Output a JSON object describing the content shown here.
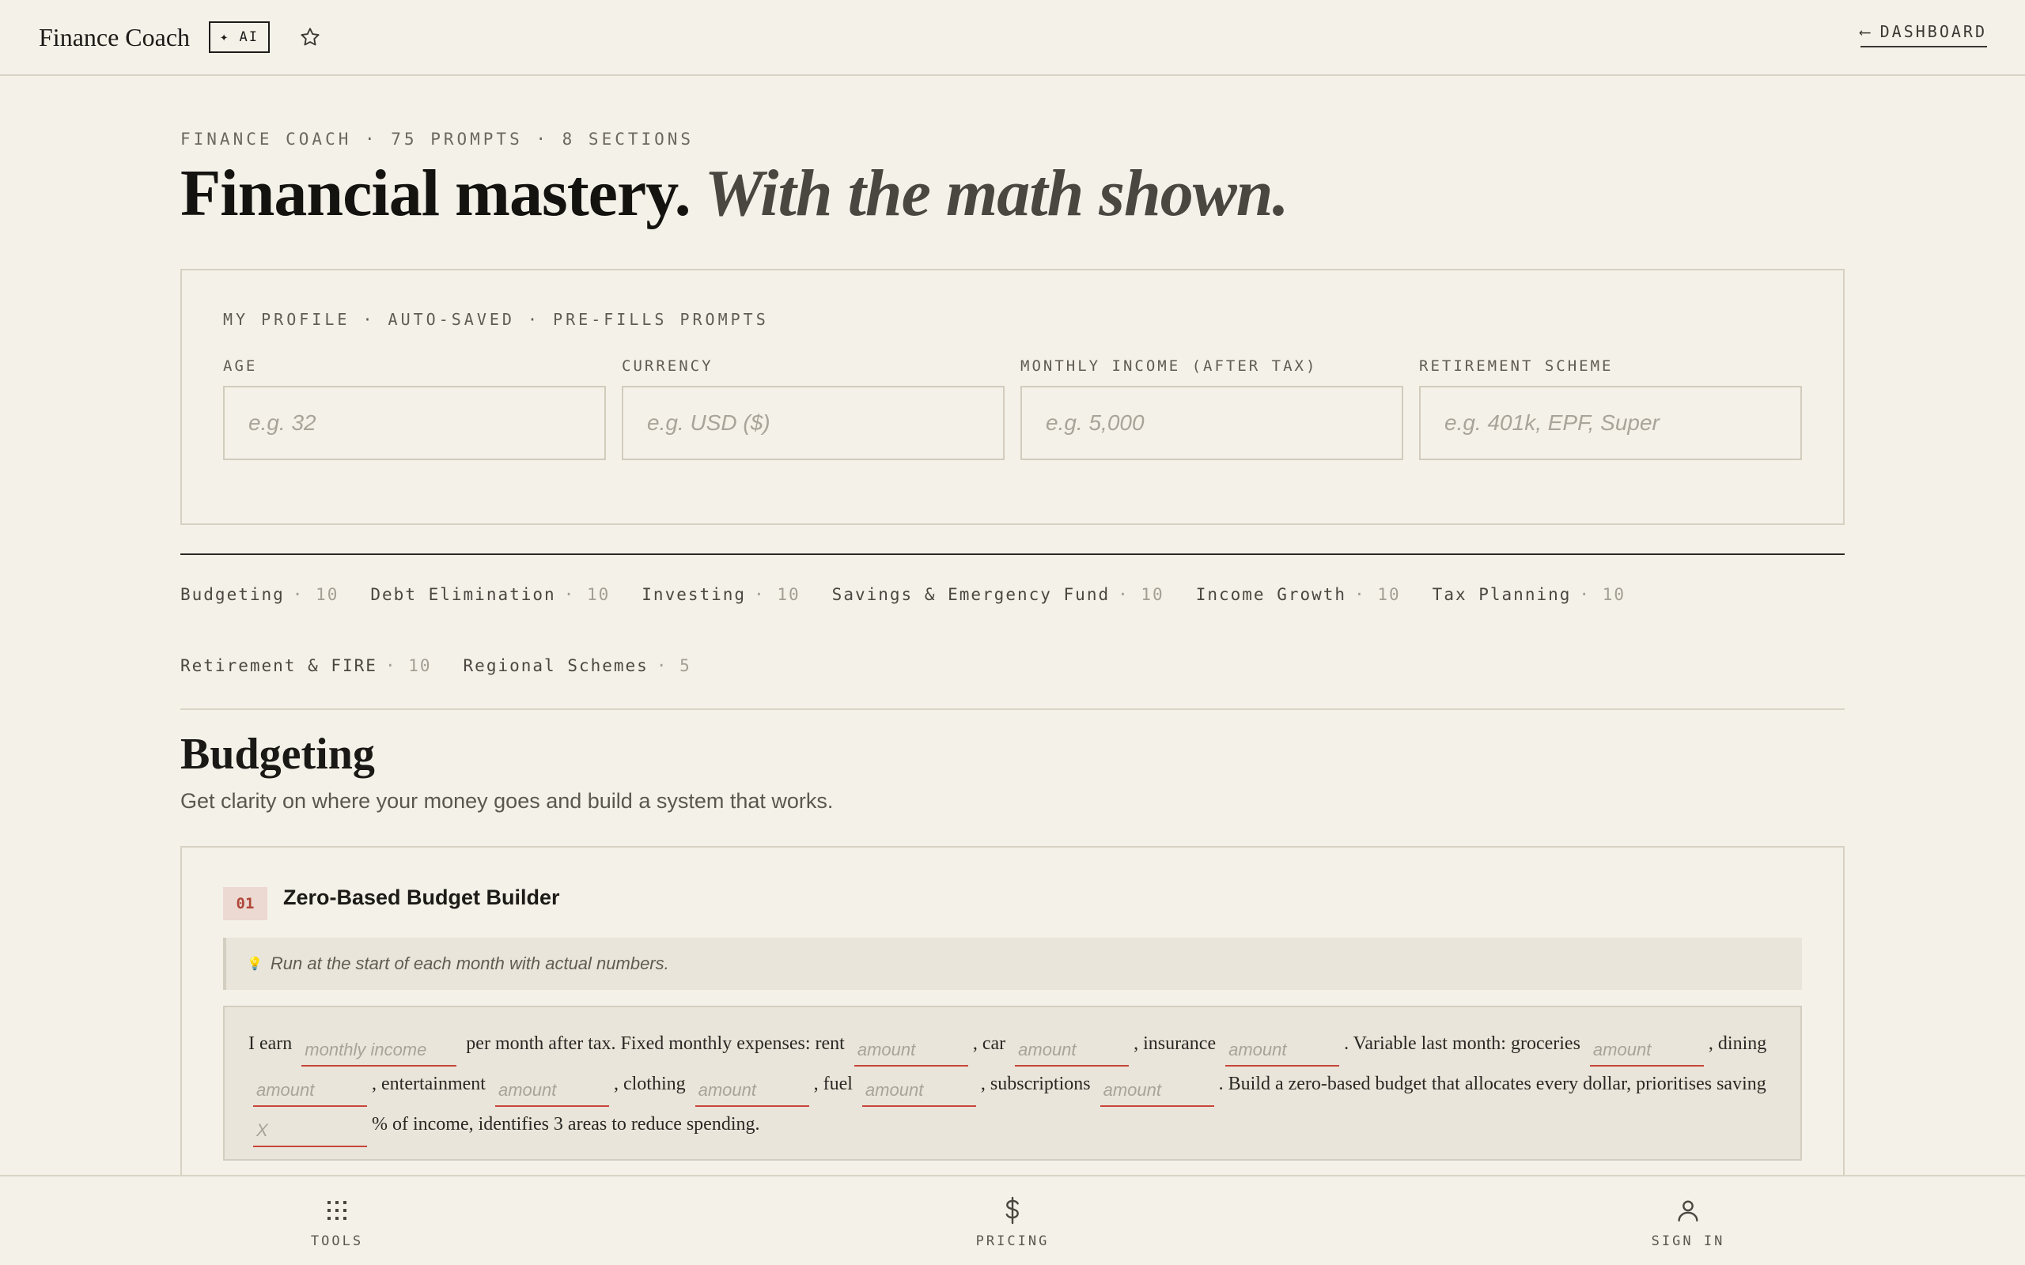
{
  "header": {
    "app_title": "Finance Coach",
    "ai_badge": "✦ AI",
    "favorite_icon": "star-icon",
    "back_arrow": "⟵",
    "dashboard_link": "DASHBOARD"
  },
  "hero": {
    "eyebrow": "FINANCE COACH · 75 PROMPTS · 8 SECTIONS",
    "headline": "Financial mastery.",
    "headline_italic": "With the math shown."
  },
  "profile": {
    "eyebrow": "MY PROFILE · AUTO-SAVED · PRE-FILLS PROMPTS",
    "fields": [
      {
        "label": "AGE",
        "placeholder": "e.g. 32",
        "value": ""
      },
      {
        "label": "CURRENCY",
        "placeholder": "e.g. USD ($)",
        "value": ""
      },
      {
        "label": "MONTHLY INCOME (AFTER TAX)",
        "placeholder": "e.g. 5,000",
        "value": ""
      },
      {
        "label": "RETIREMENT SCHEME",
        "placeholder": "e.g. 401k, EPF, Super",
        "value": ""
      }
    ]
  },
  "categories": [
    {
      "label": "Budgeting",
      "count": "10"
    },
    {
      "label": "Debt Elimination",
      "count": "10"
    },
    {
      "label": "Investing",
      "count": "10"
    },
    {
      "label": "Savings & Emergency Fund",
      "count": "10"
    },
    {
      "label": "Income Growth",
      "count": "10"
    },
    {
      "label": "Tax Planning",
      "count": "10"
    },
    {
      "label": "Retirement & FIRE",
      "count": "10"
    },
    {
      "label": "Regional Schemes",
      "count": "5"
    }
  ],
  "section": {
    "title": "Budgeting",
    "description": "Get clarity on where your money goes and build a system that works."
  },
  "prompt_card": {
    "number": "01",
    "title": "Zero-Based Budget Builder",
    "tip": "Run at the start of each month with actual numbers.",
    "tip_icon": "lightbulb-icon",
    "text": {
      "t1": "I earn",
      "b1": "monthly income",
      "t2": "per month after tax. Fixed monthly expenses: rent",
      "b2": "amount",
      "t3": ", car",
      "b3": "amount",
      "t4": ", insurance",
      "b4": "amount",
      "t5": ". Variable last month: groceries",
      "b5": "amount",
      "t6": ", dining",
      "b6": "amount",
      "t7": ", entertainment",
      "b7": "amount",
      "t8": ", clothing",
      "b8": "amount",
      "t9": ", fuel",
      "b9": "amount",
      "t10": ", subscriptions",
      "b10": "amount",
      "t11": ". Build a zero-based budget that allocates every dollar, prioritises saving",
      "b11": "X",
      "t12": "% of income, identifies 3 areas to reduce spending."
    }
  },
  "bottom_nav": [
    {
      "label": "TOOLS",
      "icon": "grid-icon"
    },
    {
      "label": "PRICING",
      "icon": "dollar-icon"
    },
    {
      "label": "SIGN IN",
      "icon": "user-icon"
    }
  ],
  "colors": {
    "background": "#f4f1e8",
    "text": "#1c1b18",
    "accent_red": "#c9453a",
    "badge_bg": "#ecd9d1",
    "panel_bg": "#e9e5da"
  }
}
